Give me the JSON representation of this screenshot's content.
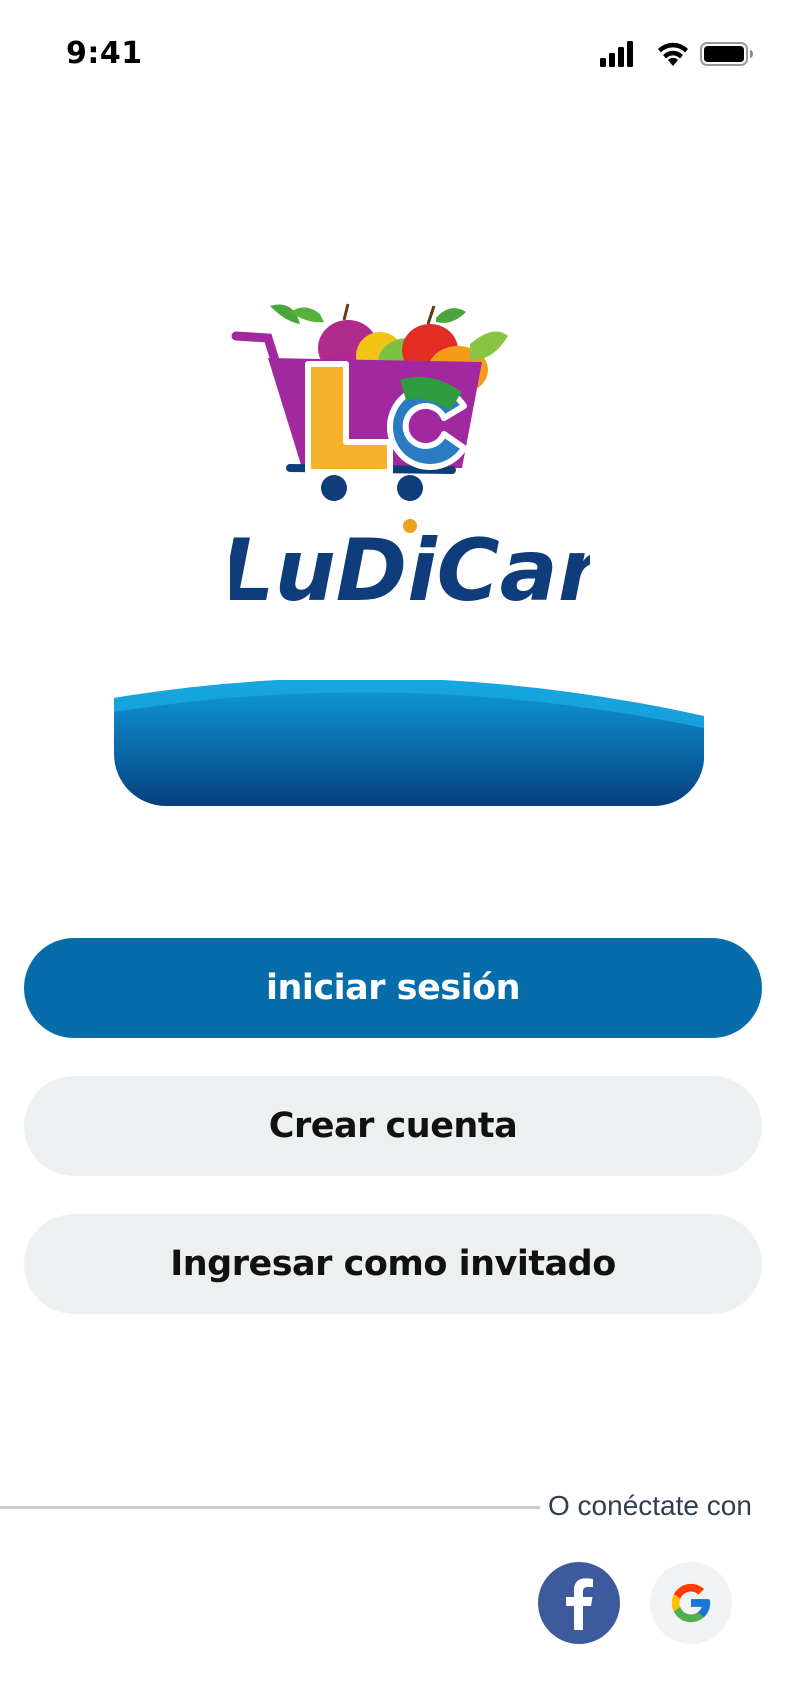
{
  "status_bar": {
    "time": "9:41",
    "icons": [
      "signal-icon",
      "wifi-icon",
      "battery-icon"
    ]
  },
  "brand": {
    "name": "LuDiCar",
    "initials": "LC",
    "colors": {
      "navy": "#0f3c7a",
      "magenta": "#a2289f",
      "orange": "#f0a01e",
      "green": "#2f9c3f",
      "blue": "#2a7cc2"
    }
  },
  "actions": {
    "login_label": "iniciar sesión",
    "create_account_label": "Crear cuenta",
    "guest_label": "Ingresar como invitado"
  },
  "social": {
    "connect_text": "O conéctate con",
    "providers": [
      "facebook-icon",
      "google-icon"
    ]
  },
  "colors": {
    "primary": "#066daa",
    "secondary_bg": "#edf0f1",
    "divider": "#c9ccd3",
    "facebook": "#3d5a9d"
  }
}
